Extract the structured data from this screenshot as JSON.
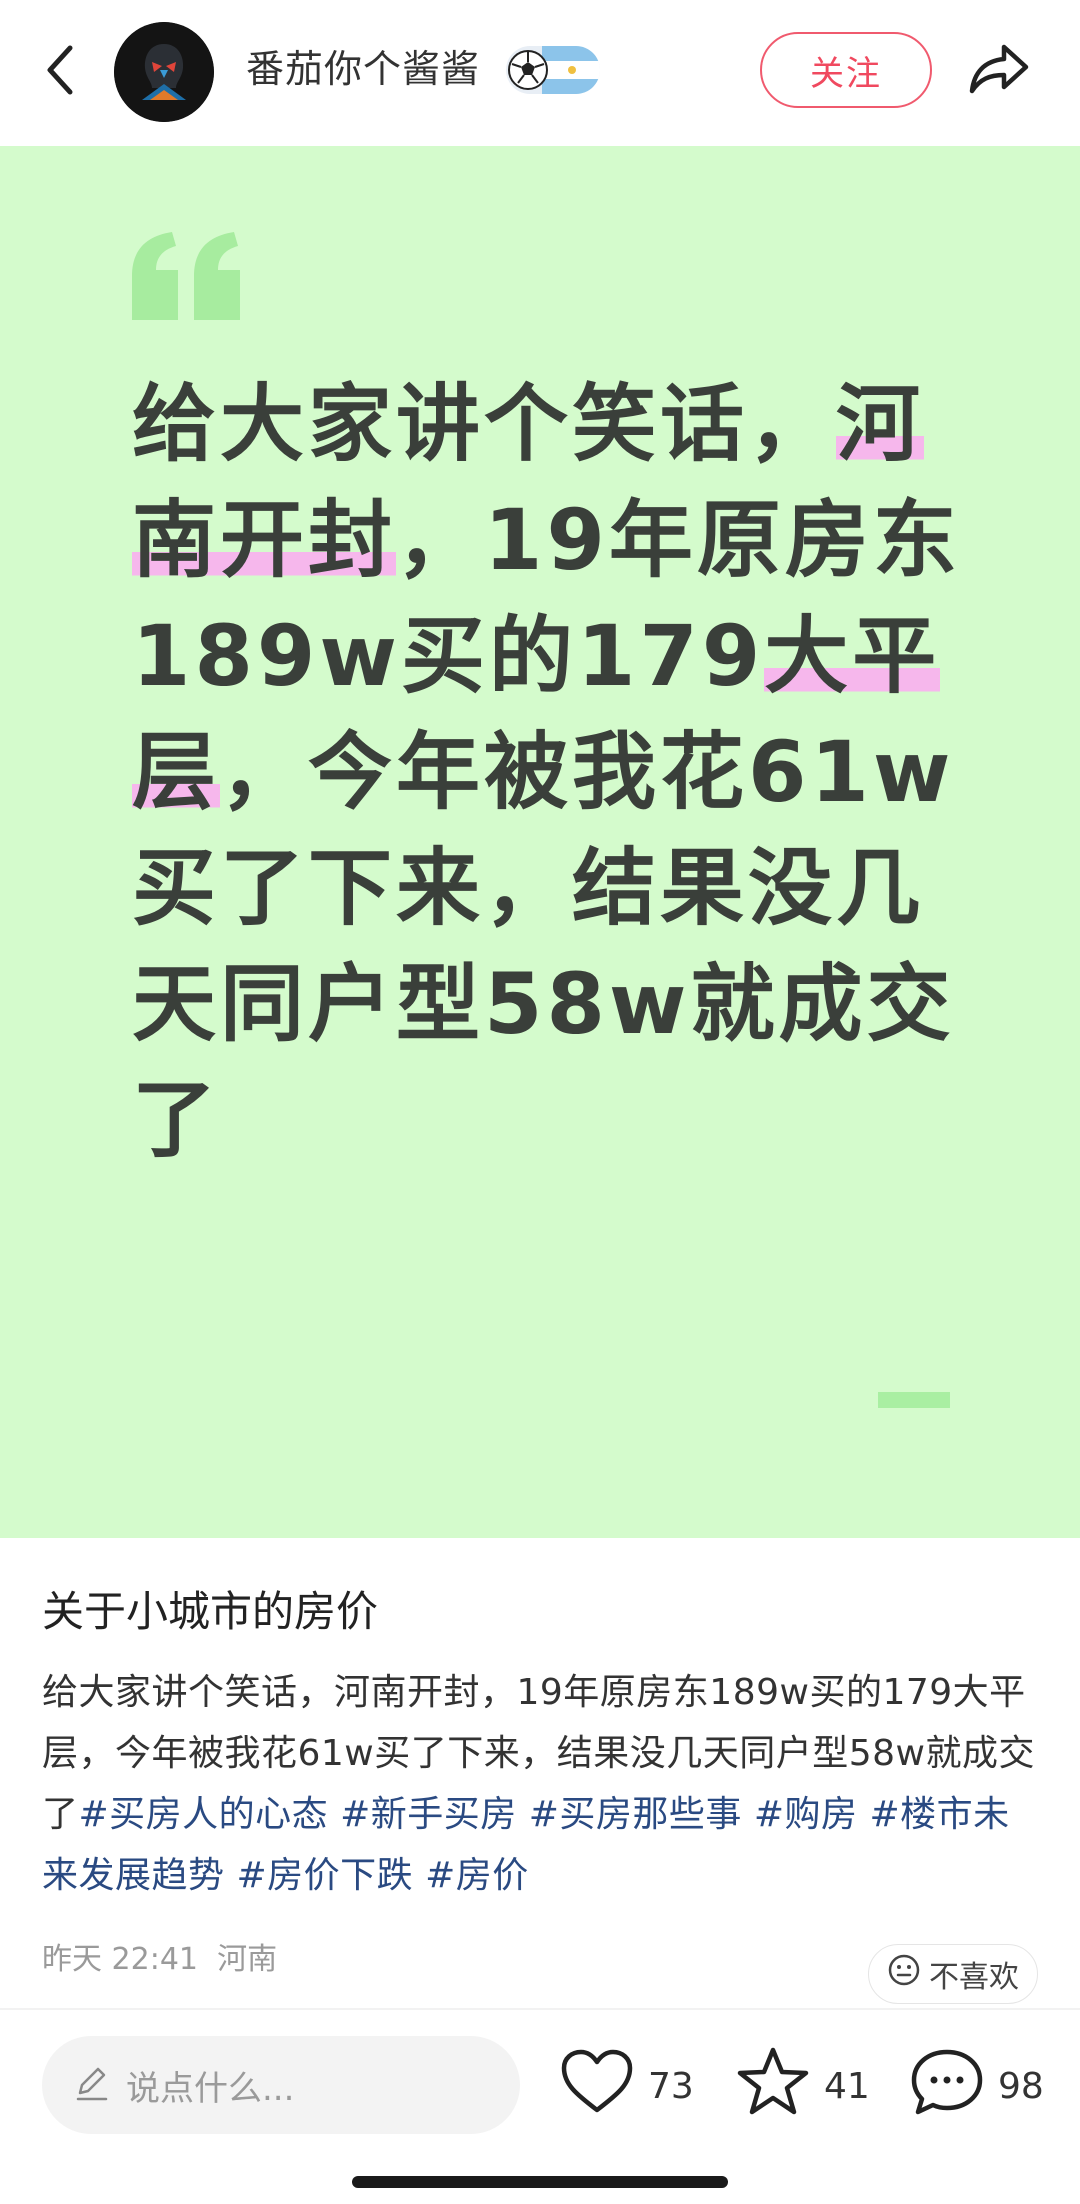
{
  "header": {
    "username": "番茄你个酱酱",
    "follow_label": "关注",
    "back_icon": "chevron-left-icon",
    "share_icon": "share-arrow-icon"
  },
  "quote": {
    "segments": [
      {
        "text": "给大家讲个笑话，",
        "hl": false
      },
      {
        "text": "河南开封",
        "hl": true
      },
      {
        "text": "，19年原房东189w买的179",
        "hl": false
      },
      {
        "text": "大平层",
        "hl": true
      },
      {
        "text": "，今年被我花61w买了下来，结果没几天同户型58w就成交了",
        "hl": false
      }
    ],
    "background_color": "#d4fbcc",
    "highlight_color": "#f6b7ec"
  },
  "post": {
    "title": "关于小城市的房价",
    "body": "给大家讲个笑话，河南开封，19年原房东189w买的179大平层，今年被我花61w买了下来，结果没几天同户型58w就成交了",
    "tags": [
      "#买房人的心态",
      "#新手买房",
      "#买房那些事",
      "#购房",
      "#楼市未来发展趋势",
      "#房价下跌",
      "#房价"
    ],
    "time": "昨天 22:41",
    "location": "河南",
    "dislike_label": "不喜欢"
  },
  "bottom": {
    "comment_placeholder": "说点什么...",
    "likes": "73",
    "favorites": "41",
    "comments": "98"
  }
}
